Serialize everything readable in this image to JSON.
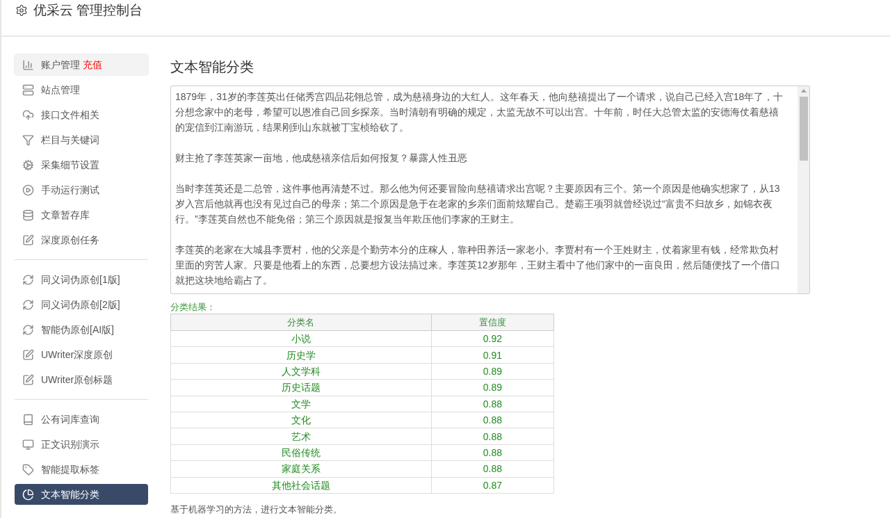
{
  "header": {
    "title": "优采云 管理控制台"
  },
  "sidebar": {
    "groups": [
      [
        {
          "label": "账户管理",
          "badge": "充值",
          "hovered": true,
          "selected": false
        },
        {
          "label": "站点管理",
          "hovered": false,
          "selected": false
        },
        {
          "label": "接口文件相关",
          "hovered": false,
          "selected": false
        },
        {
          "label": "栏目与关键词",
          "hovered": false,
          "selected": false
        },
        {
          "label": "采集细节设置",
          "hovered": false,
          "selected": false
        },
        {
          "label": "手动运行测试",
          "hovered": false,
          "selected": false
        },
        {
          "label": "文章暂存库",
          "hovered": false,
          "selected": false
        },
        {
          "label": "深度原创任务",
          "hovered": false,
          "selected": false
        }
      ],
      [
        {
          "label": "同义词伪原创[1版]",
          "hovered": false,
          "selected": false
        },
        {
          "label": "同义词伪原创[2版]",
          "hovered": false,
          "selected": false
        },
        {
          "label": "智能伪原创[AI版]",
          "hovered": false,
          "selected": false
        },
        {
          "label": "UWriter深度原创",
          "hovered": false,
          "selected": false
        },
        {
          "label": "UWriter原创标题",
          "hovered": false,
          "selected": false
        }
      ],
      [
        {
          "label": "公有词库查询",
          "hovered": false,
          "selected": false
        },
        {
          "label": "正文识别演示",
          "hovered": false,
          "selected": false
        },
        {
          "label": "智能提取标签",
          "hovered": false,
          "selected": false
        },
        {
          "label": "文本智能分类",
          "hovered": false,
          "selected": true
        }
      ]
    ]
  },
  "page": {
    "title": "文本智能分类",
    "input_text": [
      "1879年，31岁的李莲英出任储秀宫四品花翎总管，成为慈禧身边的大红人。这年春天，他向慈禧提出了一个请求，说自己已经入宫18年了，十分想念家中的老母，希望可以恩准自己回乡探亲。当时清朝有明确的规定，太监无故不可以出宫。十年前，时任大总管太监的安德海仗着慈禧的宠信到江南游玩，结果刚到山东就被丁宝桢给砍了。",
      "财主抢了李莲英家一亩地，他成慈禧亲信后如何报复？暴露人性丑恶",
      "当时李莲英还是二总管，这件事他再清楚不过。那么他为何还要冒险向慈禧请求出宫呢？主要原因有三个。第一个原因是他确实想家了，从13岁入宫后他就再也没有见过自己的母亲；第二个原因是急于在老家的乡亲们面前炫耀自己。楚霸王项羽就曾经说过“富贵不归故乡，如锦衣夜行。”李莲英自然也不能免俗；第三个原因就是报复当年欺压他们李家的王财主。",
      "李莲英的老家在大城县李贾村，他的父亲是个勤劳本分的庄稼人，靠种田养活一家老小。李贾村有一个王姓财主，仗着家里有钱，经常欺负村里面的穷苦人家。只要是他看上的东西，总要想方设法搞过来。李莲英12岁那年，王财主看中了他们家中的一亩良田，然后随便找了一个借口就把这块地给霸占了。"
    ],
    "result_label": "分类结果：",
    "table": {
      "columns": [
        "分类名",
        "置信度"
      ],
      "rows": [
        [
          "小说",
          "0.92"
        ],
        [
          "历史学",
          "0.91"
        ],
        [
          "人文学科",
          "0.89"
        ],
        [
          "历史话题",
          "0.89"
        ],
        [
          "文学",
          "0.88"
        ],
        [
          "文化",
          "0.88"
        ],
        [
          "艺术",
          "0.88"
        ],
        [
          "民俗传统",
          "0.88"
        ],
        [
          "家庭关系",
          "0.88"
        ],
        [
          "其他社会话题",
          "0.87"
        ]
      ]
    },
    "note": "基于机器学习的方法，进行文本智能分类。"
  }
}
